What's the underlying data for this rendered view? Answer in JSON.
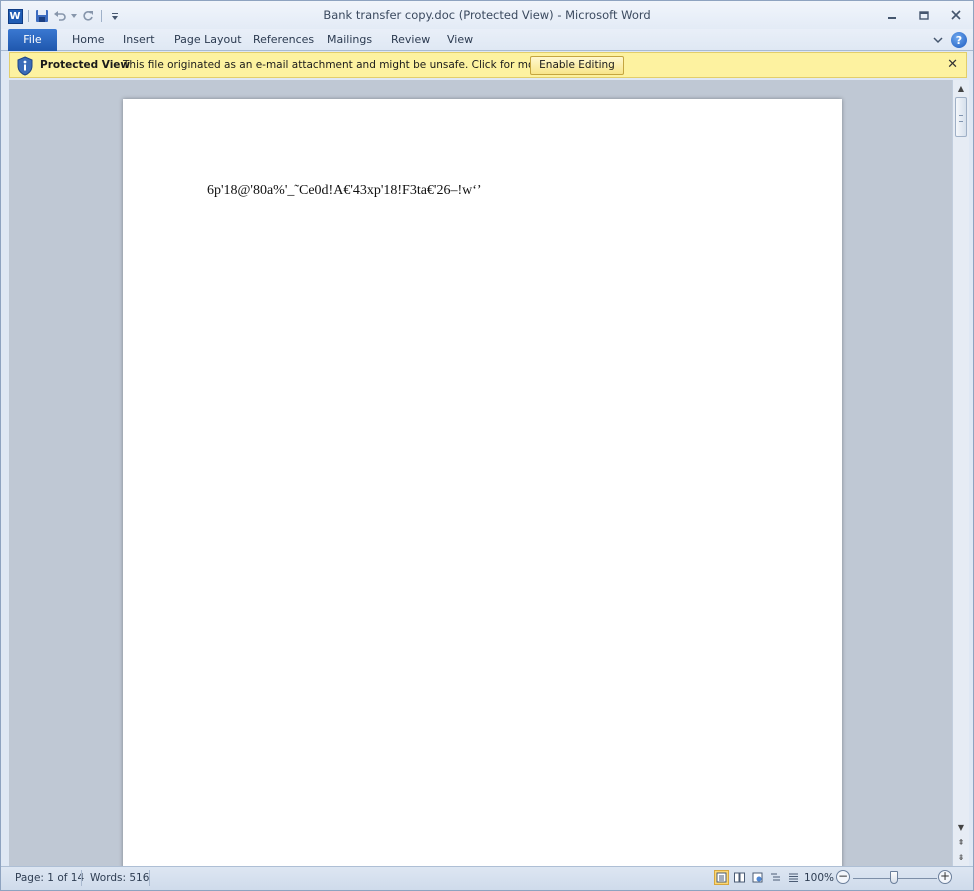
{
  "window": {
    "title": "Bank transfer copy.doc (Protected View)  -  Microsoft Word"
  },
  "quick_access": {
    "app_icon": "word-logo-icon",
    "app_letter": "W",
    "items": [
      "save-icon",
      "undo-icon",
      "redo-icon",
      "customize-qat-icon"
    ]
  },
  "window_controls": {
    "minimize": "–",
    "restore": "❐",
    "close": "✕"
  },
  "ribbon": {
    "tabs": [
      "File",
      "Home",
      "Insert",
      "Page Layout",
      "References",
      "Mailings",
      "Review",
      "View"
    ],
    "minimize_icon": "chevron-icon",
    "help": "?"
  },
  "protected_view": {
    "title": "Protected View",
    "message": "This file originated as an e-mail attachment and might be unsafe. Click for more details.",
    "enable_button": "Enable Editing",
    "close": "✕",
    "icon": "shield-info-icon"
  },
  "document": {
    "text": "6p'18@'80a%'_˜Ce0d!A€'43xp'18!F3ta€'26–!w‘’"
  },
  "status_bar": {
    "page": "Page: 1 of 14",
    "words": "Words: 516",
    "zoom": "100%",
    "zoom_level_percent": 100,
    "zoom_minus": "−",
    "zoom_plus": "+"
  }
}
